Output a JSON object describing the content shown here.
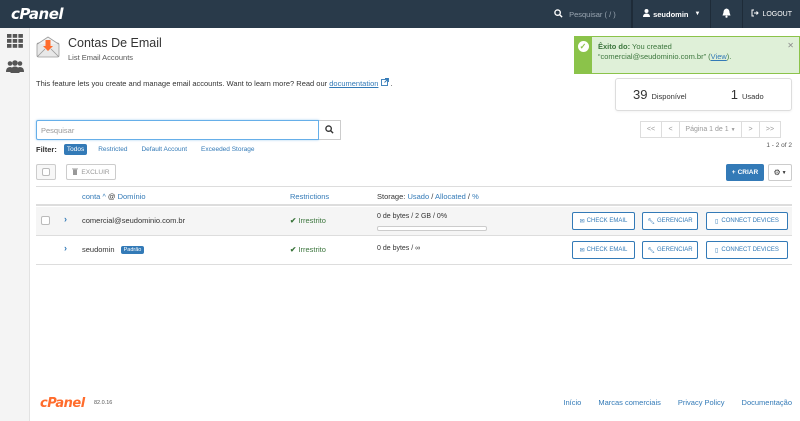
{
  "topbar": {
    "logo": "cPanel",
    "search_placeholder": "Pesquisar ( / )",
    "username": "seudomin",
    "logout": "LOGOUT"
  },
  "page": {
    "title": "Contas De Email",
    "subtitle": "List Email Accounts",
    "intro_text": "This feature lets you create and manage email accounts. Want to learn more? Read our",
    "intro_link": "documentation",
    "intro_end": "."
  },
  "alert": {
    "heading": "Êxito do:",
    "message": "You created",
    "email": "“comercial@seudominio.com.br”",
    "link": "View"
  },
  "stats": {
    "available_num": "39",
    "available_label": "Disponível",
    "used_num": "1",
    "used_label": "Usado"
  },
  "search": {
    "placeholder": "Pesquisar"
  },
  "pager": {
    "first": "<<",
    "prev": "<",
    "page_label": "Página 1 de 1",
    "next": ">",
    "last": ">>",
    "range": "1 - 2 of 2"
  },
  "filter": {
    "label": "Filter:",
    "options": [
      "Todos",
      "Restricted",
      "Default Account",
      "Exceeded Storage"
    ]
  },
  "actions": {
    "delete": "EXCLUIR",
    "create": "CRIAR"
  },
  "table": {
    "col_account": "conta",
    "col_sep": "@",
    "col_domain": "Domínio",
    "col_restrictions": "Restrictions",
    "col_storage_prefix": "Storage:",
    "col_used": "Usado",
    "col_allocated": "Allocated",
    "col_percent": "%",
    "rows": [
      {
        "account": "comercial@seudominio.com.br",
        "badge": "",
        "restriction": "Irrestrito",
        "storage": "0 de bytes / 2 GB / 0%",
        "usage_fraction": 0
      },
      {
        "account": "seudomin",
        "badge": "Padrão",
        "restriction": "Irrestrito",
        "storage": "0 de bytes / ∞",
        "usage_fraction": null
      }
    ],
    "btn_check": "CHECK EMAIL",
    "btn_manage": "GERENCIAR",
    "btn_connect": "CONNECT DEVICES"
  },
  "footer": {
    "logo": "cPanel",
    "version": "82.0.16",
    "links": [
      "Início",
      "Marcas comerciais",
      "Privacy Policy",
      "Documentação"
    ]
  },
  "colors": {
    "topbar": "#293a4a",
    "accent": "#337ab7",
    "success": "#8bc34a",
    "brand_orange": "#ff6c2c"
  }
}
